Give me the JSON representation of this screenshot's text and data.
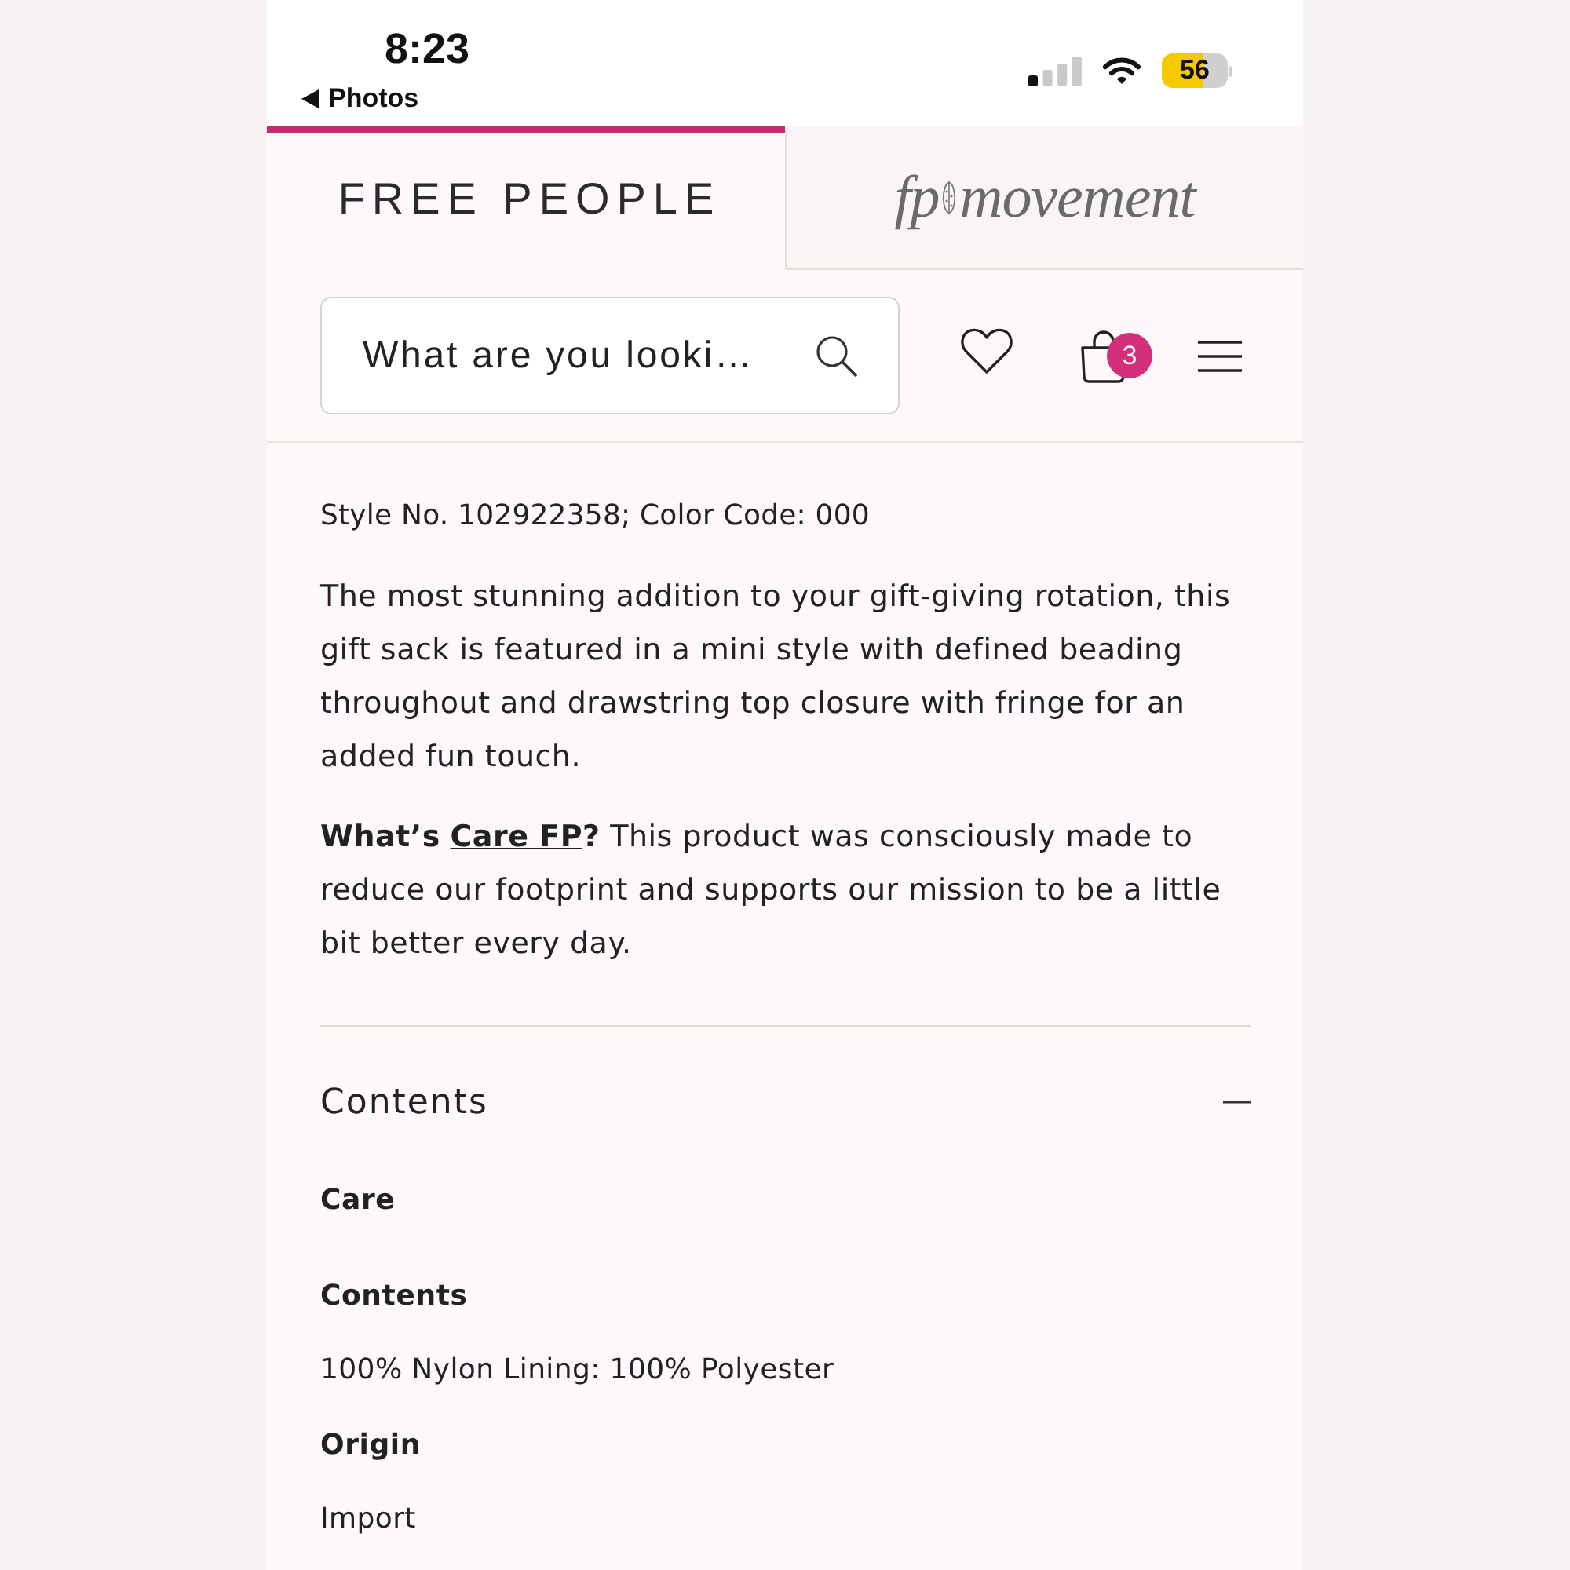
{
  "status_bar": {
    "time": "8:23",
    "back_label": "Photos",
    "battery_percent": "56"
  },
  "brand_tabs": [
    {
      "kind": "wordmark",
      "label": "FREE PEOPLE",
      "selected": true
    },
    {
      "kind": "script",
      "label_parts": [
        "fp",
        "movement"
      ],
      "selected": false
    }
  ],
  "header": {
    "search": {
      "placeholder": "What are you looki…"
    },
    "cart_count": "3"
  },
  "product_details": {
    "style_line": "Style No. 102922358; Color Code: 000",
    "description": "The most stunning addition to your gift-giving rotation, this gift sack is featured in a mini style with defined beading throughout and drawstring top closure with fringe for an added fun touch.",
    "care_note": {
      "prefix": "What’s",
      "link": "Care FP",
      "suffix": "?",
      "text": "This product was consciously made to reduce our footprint and supports our mission to be a little bit better every day."
    }
  },
  "accordion": {
    "title": "Contents",
    "expanded": true,
    "sections": [
      {
        "heading": "Care"
      },
      {
        "heading": "Contents",
        "text": "100% Nylon Lining: 100% Polyester"
      },
      {
        "heading": "Origin",
        "text": "Import"
      }
    ]
  }
}
